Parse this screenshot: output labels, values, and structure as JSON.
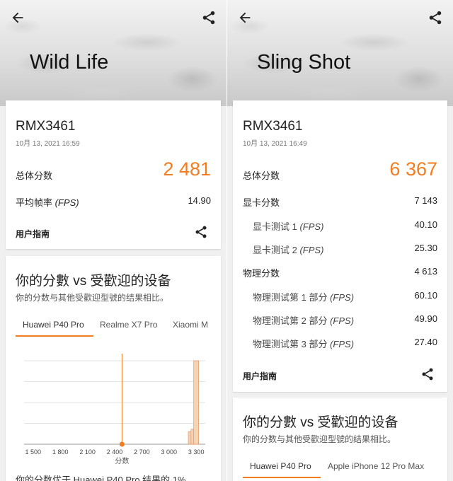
{
  "left": {
    "test_name": "Wild Life",
    "device": "RMX3461",
    "date": "10月 13, 2021 16:59",
    "total_label": "总体分数",
    "total_score": "2 481",
    "fps_label_main": "平均帧率",
    "fps_label_unit": "(FPS)",
    "fps_value": "14.90",
    "guide_label": "用户指南",
    "compare_title": "你的分數 vs 受歡迎的设备",
    "compare_subtitle": "你的分数与其他受歡迎型號的结果相比。",
    "tabs": [
      "Huawei P40 Pro",
      "Realme X7 Pro",
      "Xiaomi M"
    ],
    "bottom_text": "你的分数优于 Huawei P40 Pro 结果的 1%"
  },
  "right": {
    "test_name": "Sling Shot",
    "device": "RMX3461",
    "date": "10月 13, 2021 16:49",
    "total_label": "总体分数",
    "total_score": "6 367",
    "gpu_label": "显卡分数",
    "gpu_value": "7 143",
    "gpu_test1_main": "显卡测试 1",
    "gpu_test1_unit": "(FPS)",
    "gpu_test1_value": "40.10",
    "gpu_test2_main": "显卡测试 2",
    "gpu_test2_unit": "(FPS)",
    "gpu_test2_value": "25.30",
    "phys_label": "物理分数",
    "phys_value": "4 613",
    "phys_test1_main": "物理测试第 1 部分",
    "phys_test1_unit": "(FPS)",
    "phys_test1_value": "60.10",
    "phys_test2_main": "物理测试第 2 部分",
    "phys_test2_unit": "(FPS)",
    "phys_test2_value": "49.90",
    "phys_test3_main": "物理测试第 3 部分",
    "phys_test3_unit": "(FPS)",
    "phys_test3_value": "27.40",
    "guide_label": "用户指南",
    "compare_title": "你的分數 vs 受歡迎的设备",
    "compare_subtitle": "你的分数与其他受歡迎型號的结果相比。",
    "tabs": [
      "Huawei P40 Pro",
      "Apple iPhone 12 Pro Max"
    ]
  },
  "chart_data": {
    "type": "bar",
    "xlabel": "分数",
    "x_ticks": [
      "1 500",
      "1 800",
      "2 100",
      "2 400",
      "2 700",
      "3 000",
      "3 300"
    ],
    "x_tick_values": [
      1500,
      1800,
      2100,
      2400,
      2700,
      3000,
      3300
    ],
    "xlim": [
      1400,
      3400
    ],
    "your_score": 2481,
    "bars": [
      {
        "x": 3240,
        "value": 0.15
      },
      {
        "x": 3270,
        "value": 0.18
      },
      {
        "x": 3300,
        "value": 1.0
      }
    ],
    "grid": true
  },
  "colors": {
    "accent": "#f47c20",
    "bar_fill": "#f6d2b6"
  }
}
